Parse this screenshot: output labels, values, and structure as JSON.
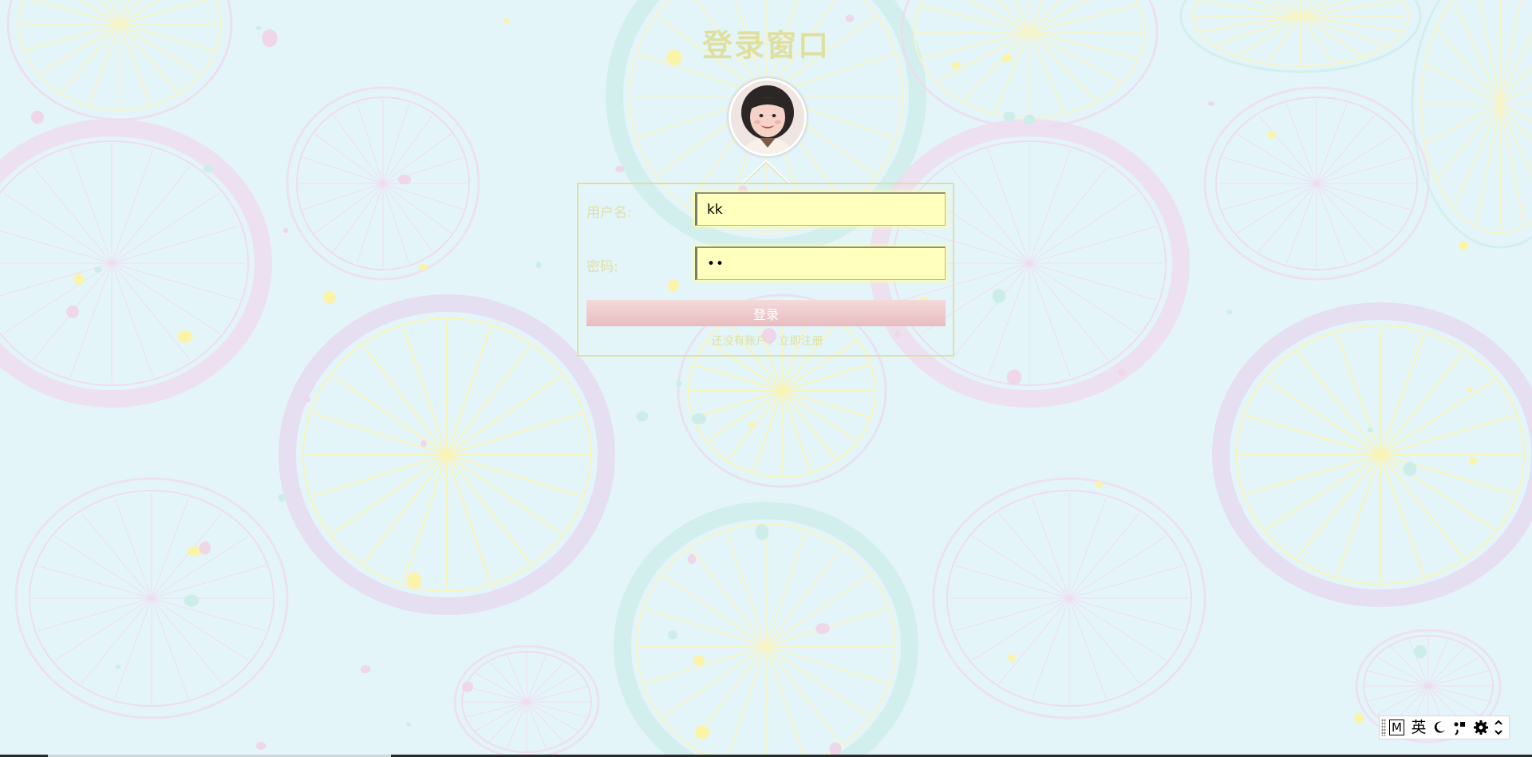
{
  "page": {
    "title": "登录窗口"
  },
  "form": {
    "username_label": "用户名:",
    "username_value": "kk",
    "password_label": "密码:",
    "password_value": "••",
    "login_label": "登录",
    "no_account_text": "还没有账户，",
    "register_link": "立即注册"
  },
  "ime_toolbar": {
    "mode_label": "M",
    "lang_label": "英",
    "icons": [
      "moon-icon",
      "punctuation-icon",
      "gear-icon",
      "more-icon"
    ]
  },
  "colors": {
    "background": "#e4f5fa",
    "title": "#dfe0a0",
    "input_bg": "#ffffbe",
    "button": "#e8bcc0"
  }
}
